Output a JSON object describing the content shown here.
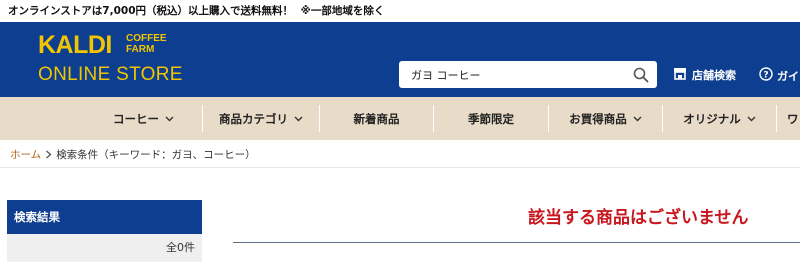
{
  "notice": {
    "text": "オンラインストアは7,000円（税込）以上購入で送料無料！",
    "note": "※一部地域を除く"
  },
  "header": {
    "logo_kaldi": "KALDI",
    "logo_coffee": "COFFEE",
    "logo_farm": "FARM",
    "logo_store": "ONLINE STORE",
    "search_value": "ガヨ コーヒー",
    "store_search_label": "店舗検索",
    "guide_label": "ガイ"
  },
  "nav": {
    "items": [
      {
        "label": "コーヒー",
        "has_dropdown": true
      },
      {
        "label": "商品カテゴリ",
        "has_dropdown": true
      },
      {
        "label": "新着商品",
        "has_dropdown": false
      },
      {
        "label": "季節限定",
        "has_dropdown": false
      },
      {
        "label": "お買得商品",
        "has_dropdown": true
      },
      {
        "label": "オリジナル",
        "has_dropdown": true
      },
      {
        "label": "ワ",
        "has_dropdown": false
      }
    ]
  },
  "breadcrumb": {
    "home": "ホーム",
    "current": "検索条件（キーワード：ガヨ、コーヒー）"
  },
  "sidebar": {
    "title": "検索結果",
    "count": "全0件"
  },
  "main": {
    "no_result_message": "該当する商品はございません"
  },
  "colors": {
    "brand_blue": "#0d3e8f",
    "logo_yellow": "#f2c500",
    "nav_beige": "#e8dcc9",
    "alert_red": "#c9151e",
    "crumb_link": "#b5651d"
  }
}
